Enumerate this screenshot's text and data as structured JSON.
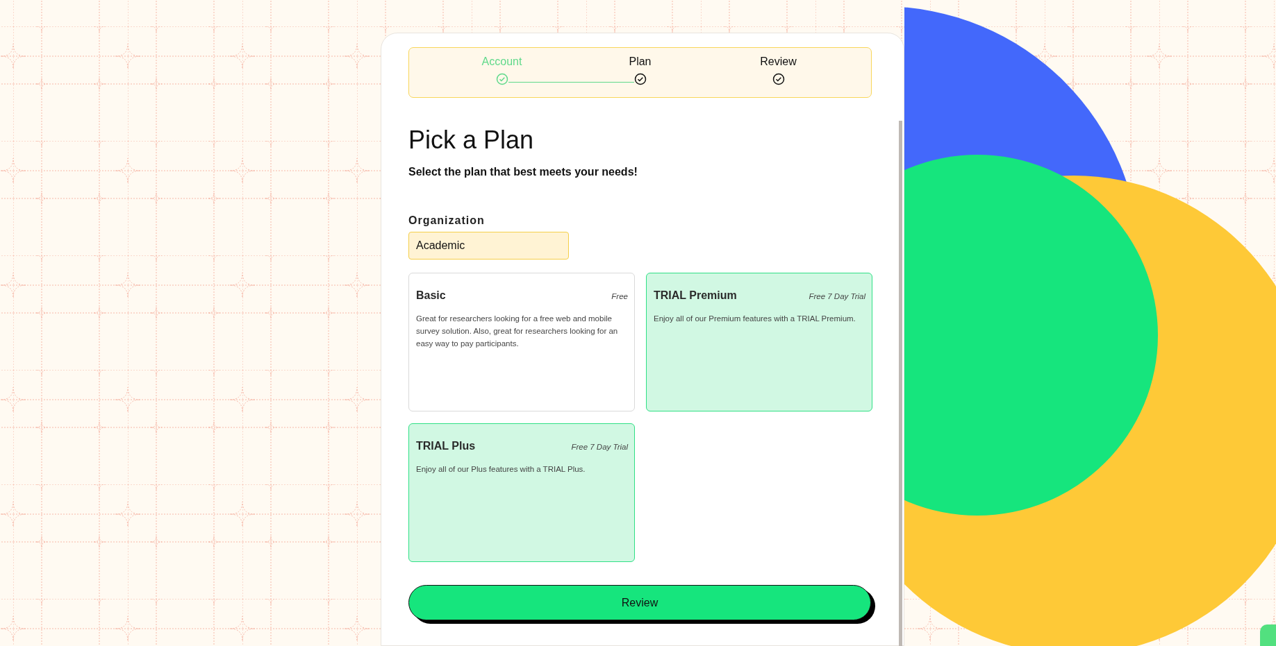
{
  "steps": [
    {
      "label": "Account",
      "completed": true
    },
    {
      "label": "Plan",
      "completed": false
    },
    {
      "label": "Review",
      "completed": false
    }
  ],
  "title": "Pick a Plan",
  "subtitle": "Select the plan that best meets your needs!",
  "organization": {
    "label": "Organization",
    "value": "Academic"
  },
  "plans": [
    {
      "kind": "free",
      "name": "Basic",
      "price": "Free",
      "description": "Great for researchers looking for a free web and mobile survey solution. Also, great for researchers looking for an easy way to pay participants."
    },
    {
      "kind": "trial",
      "name": "TRIAL Premium",
      "price": "Free 7 Day Trial",
      "description": "Enjoy all of our Premium features with a TRIAL Premium."
    },
    {
      "kind": "trial",
      "name": "TRIAL Plus",
      "price": "Free 7 Day Trial",
      "description": "Enjoy all of our Plus features with a TRIAL Plus."
    }
  ],
  "review_button": "Review"
}
